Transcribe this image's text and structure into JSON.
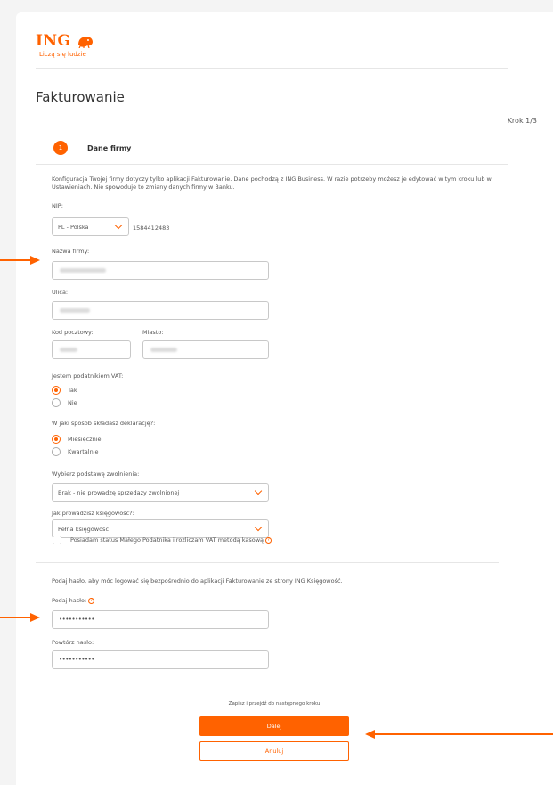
{
  "brand": {
    "name": "ING",
    "slogan": "Liczą się ludzie",
    "color": "#ff6200",
    "logo_icon": "lion-icon"
  },
  "page": {
    "title": "Fakturowanie",
    "step": "Krok 1/3"
  },
  "step_section": {
    "number": "1",
    "name": "Dane firmy"
  },
  "intro": "Konfiguracja Twojej firmy dotyczy tylko aplikacji Fakturowanie. Dane pochodzą z ING Business. W razie potrzeby możesz je edytować w tym kroku lub w Ustawieniach. Nie spowoduje to zmiany danych firmy w Banku.",
  "form": {
    "nip": {
      "label": "NIP:",
      "country": "PL - Polska",
      "value": "1584412483"
    },
    "company_name": {
      "label": "Nazwa firmy:"
    },
    "street": {
      "label": "Ulica:"
    },
    "postal_code": {
      "label": "Kod pocztowy:"
    },
    "city": {
      "label": "Miasto:"
    },
    "vat_payer": {
      "label": "Jestem podatnikiem VAT:",
      "options": [
        "Tak",
        "Nie"
      ],
      "selected": "Tak"
    },
    "declaration": {
      "label": "W jaki sposób składasz deklarację?:",
      "options": [
        "Miesięcznie",
        "Kwartalnie"
      ],
      "selected": "Miesięcznie"
    },
    "exemption": {
      "label": "Wybierz podstawę zwolnienia:",
      "value": "Brak - nie prowadzę sprzedaży zwolnionej"
    },
    "accounting": {
      "label": "Jak prowadzisz księgowość?:",
      "value": "Pełna księgowość"
    },
    "small_taxpayer": {
      "label": "Posiadam status Małego Podatnika i rozliczam VAT metodą kasową",
      "checked": false
    },
    "password_intro": "Podaj hasło, aby móc logować się bezpośrednio do aplikacji Fakturowanie ze strony ING Księgowość.",
    "password": {
      "label": "Podaj hasło:",
      "value": "•••••••••••"
    },
    "password_repeat": {
      "label": "Powtórz hasło:",
      "value": "•••••••••••"
    }
  },
  "footer": {
    "note": "Zapisz i przejdź do następnego kroku",
    "next": "Dalej",
    "cancel": "Anuluj"
  }
}
